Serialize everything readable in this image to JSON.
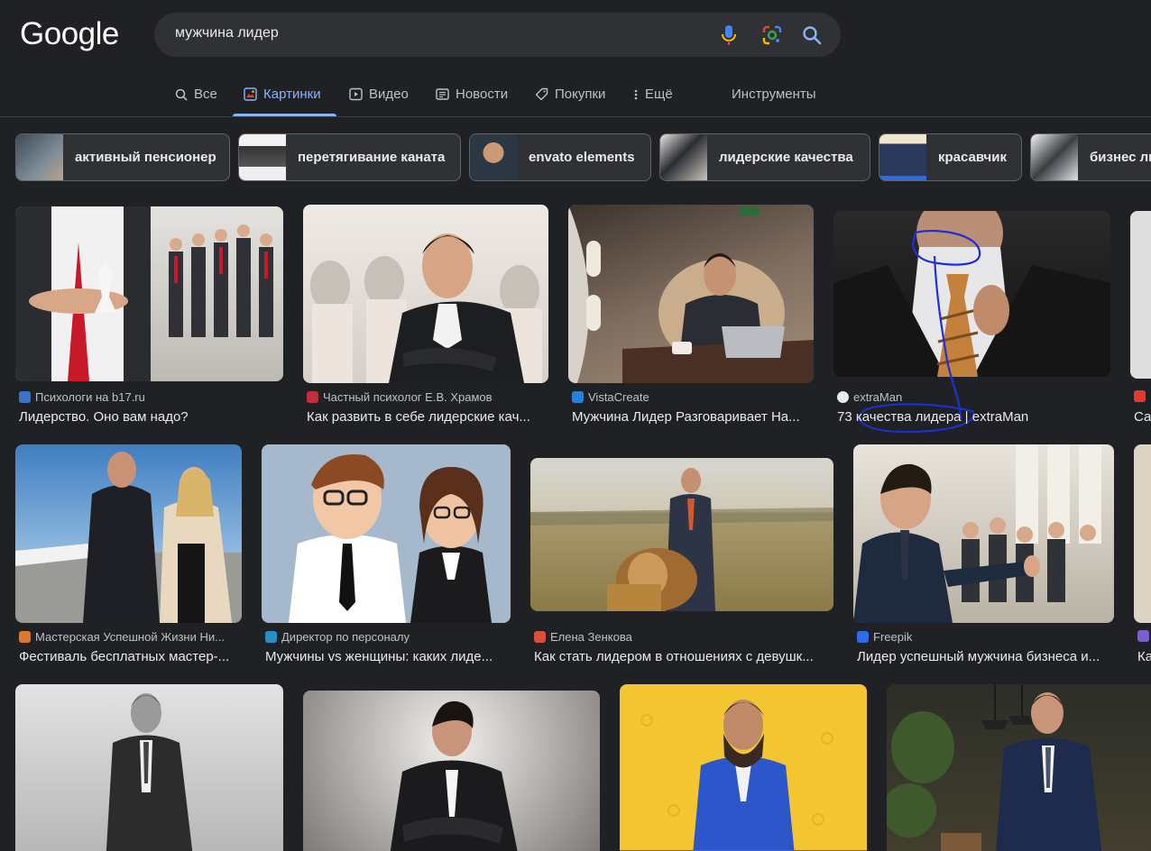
{
  "header": {
    "logo": "Google",
    "query": "мужчина лидер"
  },
  "tabs": {
    "all": "Все",
    "images": "Картинки",
    "video": "Видео",
    "news": "Новости",
    "shopping": "Покупки",
    "more": "Ещё",
    "tools": "Инструменты"
  },
  "chips": [
    {
      "label": "активный пенсионер",
      "color": "#5b6a78"
    },
    {
      "label": "перетягивание каната",
      "color": "#d9d9d9"
    },
    {
      "label": "envato elements",
      "color": "#8a7a66"
    },
    {
      "label": "лидерские качества",
      "color": "#c9c3bb"
    },
    {
      "label": "красавчик",
      "color": "#e6dcc7"
    },
    {
      "label": "бизнес лидер",
      "color": "#cfd3d8"
    }
  ],
  "results": [
    {
      "source": "Психологи на b17.ru",
      "title": "Лидерство. Оно вам надо?",
      "fav": "#3b73c7",
      "bg": "#c8c5c0"
    },
    {
      "source": "Частный психолог Е.В. Храмов",
      "title": "Как развить в себе лидерские кач...",
      "fav": "#c0303a",
      "bg": "#d9d5cf"
    },
    {
      "source": "VistaCreate",
      "title": "Мужчина Лидер Разговаривает На...",
      "fav": "#2a7fd6",
      "bg": "#6e625a"
    },
    {
      "source": "extraMan",
      "title": "73 качества лидера | extraMan",
      "fav": "#e8eaed",
      "bg": "#1a1a1a"
    },
    {
      "source": "",
      "title": "Са",
      "fav": "#e33a2f",
      "bg": "#dedede"
    },
    {
      "source": "Мастерская Успешной Жизни Ни...",
      "title": "Фестиваль бесплатных мастер-...",
      "fav": "#e0782a",
      "bg": "#4b88c4"
    },
    {
      "source": "Директор по персоналу",
      "title": "Мужчины vs женщины: каких лиде...",
      "fav": "#2a8fc7",
      "bg": "#a5b8cc"
    },
    {
      "source": "Елена Зенкова",
      "title": "Как стать лидером в отношениях с девушк...",
      "fav": "#d94f3b",
      "bg": "#a99a6e"
    },
    {
      "source": "Freepik",
      "title": "Лидер успешный мужчина бизнеса и...",
      "fav": "#2d6ee8",
      "bg": "#c7c1b6"
    },
    {
      "source": "",
      "title": "Ка",
      "fav": "#7a5bd8",
      "bg": "#ddd4c6"
    },
    {
      "source": "",
      "title": "",
      "fav": "",
      "bg": "#bdbdbd"
    },
    {
      "source": "",
      "title": "",
      "fav": "",
      "bg": "#4d4a48"
    },
    {
      "source": "",
      "title": "",
      "fav": "",
      "bg": "#f2c531"
    },
    {
      "source": "",
      "title": "",
      "fav": "",
      "bg": "#2c2f28"
    }
  ]
}
